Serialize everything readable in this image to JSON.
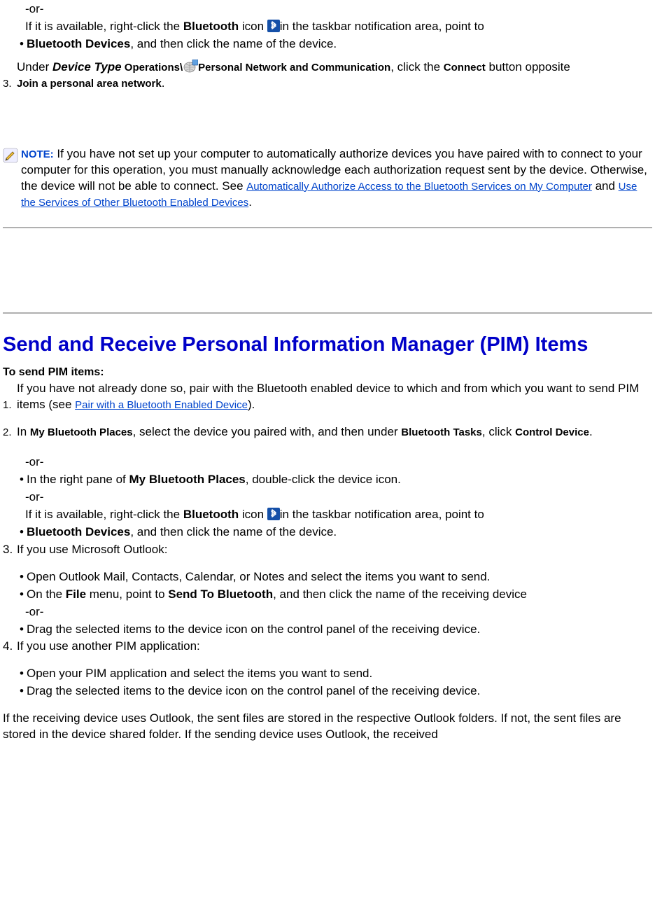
{
  "intro": {
    "or": "-or-",
    "rc_prefix": "If it is available, right-click the ",
    "rc_bt": "Bluetooth",
    "rc_mid": " icon ",
    "rc_after": "in the taskbar notification area, point to ",
    "bullet": "•",
    "bt_devices": "Bluetooth Devices",
    "bt_devices_tail": ", and then click the name of the device.",
    "step3_num": "3.",
    "step3_prefix": "Under ",
    "device_type": "Device Type",
    "operations": " Operations\\",
    "pnc": "Personal Network and Communication",
    "step3_mid": ", click the ",
    "connect": "Connect",
    "step3_tail": " button opposite ",
    "join_pan": "Join a personal area network",
    "period": "."
  },
  "note": {
    "label": "NOTE:",
    "body1": " If you have not set up your computer to automatically authorize devices you have paired with to connect to your computer for this operation, you must manually acknowledge each authorization request sent by the device. Otherwise, the device will not be able to connect. See ",
    "link1": "Automatically Authorize Access to the Bluetooth Services on My Computer",
    "and": " and ",
    "link2": "Use the Services of Other Bluetooth Enabled Devices",
    "period": "."
  },
  "pim": {
    "heading": "Send and Receive Personal Information Manager (PIM) Items",
    "to_send": "To send PIM items:",
    "s1_num": "1.",
    "s1_a": "If you have not already done so, pair with the Bluetooth enabled device to which and from which you want to send PIM items (see ",
    "s1_link": "Pair with a Bluetooth Enabled Device",
    "s1_b": ").",
    "s2_num": "2.",
    "s2_a": "In ",
    "mbp": "My Bluetooth Places",
    "s2_b": ", select the device you paired with, and then under ",
    "bt_tasks": "Bluetooth Tasks",
    "s2_c": ", click ",
    "ctrl_dev": "Control Device",
    "s2_d": ".",
    "or": "-or-",
    "bullet": "•",
    "alt1_a": "In the right pane of ",
    "alt1_mbp": "My Bluetooth Places",
    "alt1_b": ", double-click the device icon.",
    "alt2_a": "If it is available, right-click the ",
    "alt2_bt": "Bluetooth",
    "alt2_b": " icon ",
    "alt2_c": "in the taskbar notification area, point to ",
    "alt2_bd": "Bluetooth Devices",
    "alt2_d": ", and then click the name of the device.",
    "s3_num": "3.",
    "s3": "If you use Microsoft Outlook:",
    "s3b1": "Open Outlook Mail, Contacts, Calendar, or Notes and select the items you want to send.",
    "s3b2_a": "On the ",
    "file": "File",
    "s3b2_b": " menu, point to ",
    "sendto": "Send To Bluetooth",
    "s3b2_c": ", and then click the name of the receiving device",
    "s3b3": "Drag the selected items to the device icon on the control panel of the receiving device.",
    "s4_num": "4.",
    "s4": "If you use another PIM application:",
    "s4b1": "Open your PIM application and select the items you want to send.",
    "s4b2": "Drag the selected items to the device icon on the control panel of the receiving device.",
    "footer": "If the receiving device uses Outlook, the sent files are stored in the respective Outlook folders. If not, the sent files are stored in the device shared folder. If the sending device uses Outlook, the received"
  }
}
